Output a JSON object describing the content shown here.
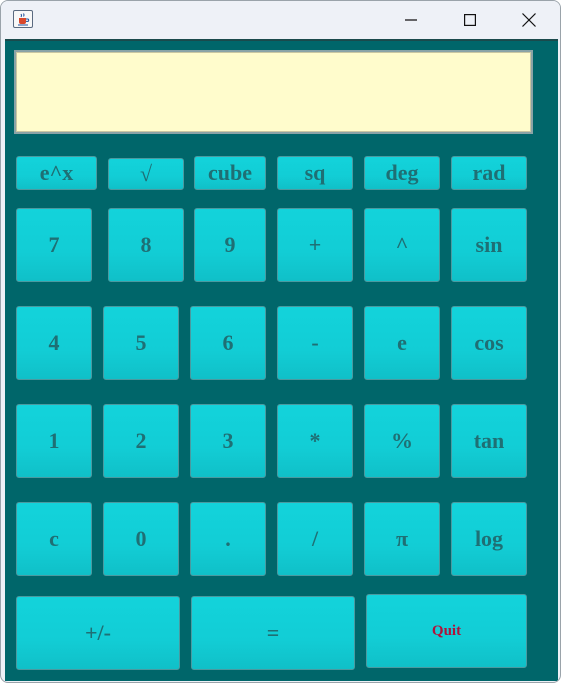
{
  "window": {
    "app_icon": "java-cup-icon",
    "minimize_icon": "minimize-icon",
    "maximize_icon": "maximize-icon",
    "close_icon": "close-icon"
  },
  "display": {
    "value": ""
  },
  "colors": {
    "panel": "#00666a",
    "display_bg": "#fffccc",
    "key_bg": "#12cdd5",
    "key_text": "#1f6f74",
    "quit_text": "#b0123a"
  },
  "keys": {
    "exp": "e^x",
    "sqrt": "√",
    "cube": "cube",
    "sq": "sq",
    "deg": "deg",
    "rad": "rad",
    "n7": "7",
    "n8": "8",
    "n9": "9",
    "plus": "+",
    "pow": "^",
    "sin": "sin",
    "n4": "4",
    "n5": "5",
    "n6": "6",
    "minus": "-",
    "e": "e",
    "cos": "cos",
    "n1": "1",
    "n2": "2",
    "n3": "3",
    "mul": "*",
    "percent": "%",
    "tan": "tan",
    "clear": "c",
    "n0": "0",
    "dot": ".",
    "div": "/",
    "pi": "π",
    "log": "log",
    "negate": "+/-",
    "equals": "=",
    "quit": "Quit"
  }
}
